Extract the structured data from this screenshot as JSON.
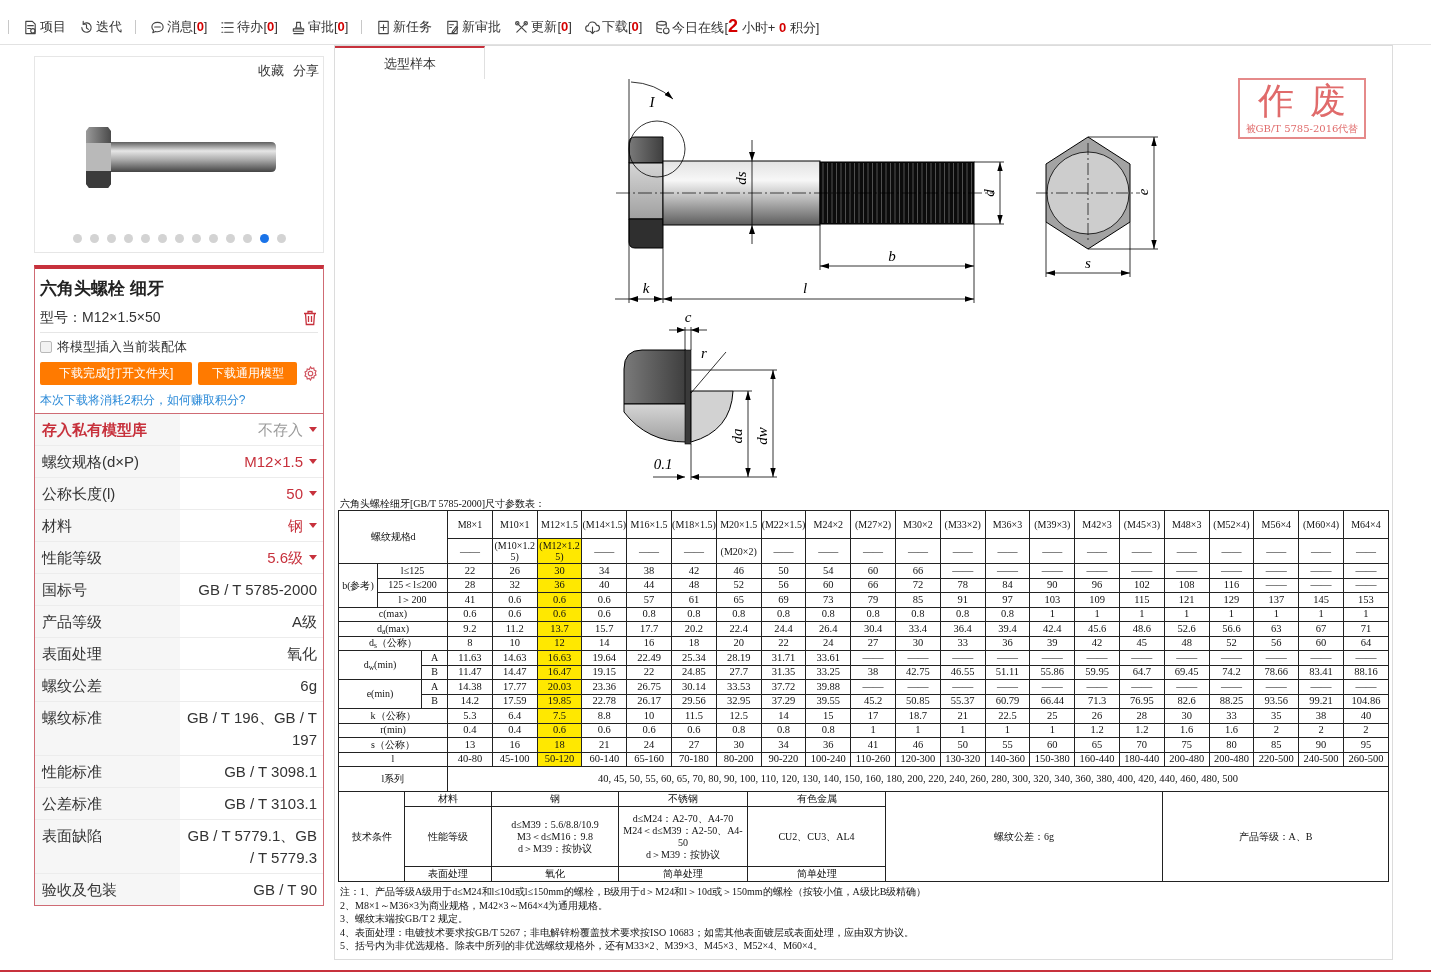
{
  "toolbar": {
    "groups": [
      {
        "items": [
          {
            "kind": "button",
            "label": "项目"
          },
          {
            "kind": "button",
            "label": "迭代"
          }
        ]
      },
      {
        "items": [
          {
            "kind": "button",
            "label": "消息[**0**]"
          },
          {
            "kind": "button",
            "label": "待办[**0**]"
          },
          {
            "kind": "button",
            "label": "审批[**0**]"
          }
        ]
      },
      {
        "items": [
          {
            "kind": "button",
            "label": "新任务"
          },
          {
            "kind": "button",
            "label": "新审批"
          },
          {
            "kind": "button",
            "label": "更新[**0**]"
          },
          {
            "kind": "button",
            "label": "下载[**0**]"
          },
          {
            "kind": "status",
            "label": "今日在线[**2** 小时+ **0** 积分]"
          }
        ]
      }
    ]
  },
  "product_card": {
    "actions": [
      "收藏",
      "分享"
    ],
    "carousel": [
      {
        "selected": false
      },
      {
        "selected": false
      },
      {
        "selected": false
      },
      {
        "selected": false
      },
      {
        "selected": false
      },
      {
        "selected": false
      },
      {
        "selected": false
      },
      {
        "selected": false
      },
      {
        "selected": false
      },
      {
        "selected": false
      },
      {
        "selected": false
      },
      {
        "selected": true
      },
      {
        "selected": false
      }
    ]
  },
  "model_card": {
    "title": "六角头螺栓 细牙",
    "model_number": "型号：M12×1.5×50",
    "insert_option": {
      "label": "将模型插入当前装配体",
      "checked": false
    },
    "buttons": [
      "下载完成[打开文件夹]",
      "下载通用模型"
    ],
    "cost_note": "本次下载将消耗2积分，如何赚取积分?",
    "properties": [
      {
        "kind": "storage",
        "label": "存入私有模型库",
        "value": "不存入"
      },
      {
        "kind": "select",
        "label": "螺纹规格(d×P)",
        "value": "M12×1.5"
      },
      {
        "kind": "select",
        "label": "公称长度(l)",
        "value": "50"
      },
      {
        "kind": "select",
        "label": "材料",
        "value": "钢"
      },
      {
        "kind": "select",
        "label": "性能等级",
        "value": "5.6级"
      },
      {
        "kind": "text",
        "label": "国标号",
        "value": "GB / T 5785-2000"
      },
      {
        "kind": "text",
        "label": "产品等级",
        "value": "A级"
      },
      {
        "kind": "text",
        "label": "表面处理",
        "value": "氧化"
      },
      {
        "kind": "text",
        "label": "螺纹公差",
        "value": "6g"
      },
      {
        "kind": "text",
        "label": "螺纹标准",
        "value": "GB / T 196、GB / T 197"
      },
      {
        "kind": "text",
        "label": "性能标准",
        "value": "GB / T 3098.1"
      },
      {
        "kind": "text",
        "label": "公差标准",
        "value": "GB / T 3103.1"
      },
      {
        "kind": "text",
        "label": "表面缺陷",
        "value": "GB / T 5779.1、GB / T 5779.3"
      },
      {
        "kind": "text",
        "label": "验收及包装",
        "value": "GB / T 90"
      }
    ]
  },
  "sample_panel": {
    "tab": {
      "label": "选型样本",
      "selected": true
    },
    "drawing": {
      "side_view_labels": [
        "ds",
        "d",
        "b",
        "k",
        "l"
      ],
      "detail_mark": "I",
      "end_view_labels": [
        "e",
        "s"
      ],
      "detail_view_labels": [
        "c",
        "r",
        "da",
        "dw",
        "0.1"
      ]
    },
    "stamp": {
      "title": "作废",
      "note": "被GB/T 5785-2016代替"
    },
    "spec_table": {
      "caption": "六角头螺栓细牙[GB/T 5785-2000]尺寸参数表：",
      "header_label": "螺纹规格d",
      "columns": [
        {
          "size": "M8×1",
          "alt": "——",
          "highlighted": false
        },
        {
          "size": "M10×1",
          "alt": "(M10×1.25)",
          "highlighted": false
        },
        {
          "size": "M12×1.5",
          "alt": "(M12×1.25)",
          "highlighted": true
        },
        {
          "size": "(M14×1.5)",
          "alt": "——",
          "highlighted": false
        },
        {
          "size": "M16×1.5",
          "alt": "——",
          "highlighted": false
        },
        {
          "size": "(M18×1.5)",
          "alt": "——",
          "highlighted": false
        },
        {
          "size": "M20×1.5",
          "alt": "(M20×2)",
          "highlighted": false
        },
        {
          "size": "(M22×1.5)",
          "alt": "——",
          "highlighted": false
        },
        {
          "size": "M24×2",
          "alt": "——",
          "highlighted": false
        },
        {
          "size": "(M27×2)",
          "alt": "——",
          "highlighted": false
        },
        {
          "size": "M30×2",
          "alt": "——",
          "highlighted": false
        },
        {
          "size": "(M33×2)",
          "alt": "——",
          "highlighted": false
        },
        {
          "size": "M36×3",
          "alt": "——",
          "highlighted": false
        },
        {
          "size": "(M39×3)",
          "alt": "——",
          "highlighted": false
        },
        {
          "size": "M42×3",
          "alt": "——",
          "highlighted": false
        },
        {
          "size": "(M45×3)",
          "alt": "——",
          "highlighted": false
        },
        {
          "size": "M48×3",
          "alt": "——",
          "highlighted": false
        },
        {
          "size": "(M52×4)",
          "alt": "——",
          "highlighted": false
        },
        {
          "size": "M56×4",
          "alt": "——",
          "highlighted": false
        },
        {
          "size": "(M60×4)",
          "alt": "——",
          "highlighted": false
        },
        {
          "size": "M64×4",
          "alt": "——",
          "highlighted": false
        }
      ],
      "rows": [
        {
          "kind": "range_group",
          "label": "b(参考)",
          "sub_rows": [
            {
              "label": "l≤125",
              "values": [
                "22",
                "26",
                "30",
                "34",
                "38",
                "42",
                "46",
                "50",
                "54",
                "60",
                "66",
                "——",
                "——",
                "——",
                "——",
                "——",
                "——",
                "——",
                "——",
                "——",
                "——"
              ]
            },
            {
              "label": "125＜l≤200",
              "values": [
                "28",
                "32",
                "36",
                "40",
                "44",
                "48",
                "52",
                "56",
                "60",
                "66",
                "72",
                "78",
                "84",
                "90",
                "96",
                "102",
                "108",
                "116",
                "——",
                "——",
                "——"
              ]
            },
            {
              "label": "l＞200",
              "values": [
                "41",
                "0.6",
                "0.6",
                "0.6",
                "57",
                "61",
                "65",
                "69",
                "73",
                "79",
                "85",
                "91",
                "97",
                "103",
                "109",
                "115",
                "121",
                "129",
                "137",
                "145",
                "153"
              ]
            }
          ]
        },
        {
          "kind": "single",
          "label": "c(max)",
          "values": [
            "0.6",
            "0.6",
            "0.6",
            "0.6",
            "0.8",
            "0.8",
            "0.8",
            "0.8",
            "0.8",
            "0.8",
            "0.8",
            "0.8",
            "0.8",
            "1",
            "1",
            "1",
            "1",
            "1",
            "1",
            "1",
            "1"
          ]
        },
        {
          "kind": "single",
          "label": "d$_{a}$(max)",
          "values": [
            "9.2",
            "11.2",
            "13.7",
            "15.7",
            "17.7",
            "20.2",
            "22.4",
            "24.4",
            "26.4",
            "30.4",
            "33.4",
            "36.4",
            "39.4",
            "42.4",
            "45.6",
            "48.6",
            "52.6",
            "56.6",
            "63",
            "67",
            "71"
          ]
        },
        {
          "kind": "single",
          "label": "d$_{s}$（公称）",
          "values": [
            "8",
            "10",
            "12",
            "14",
            "16",
            "18",
            "20",
            "22",
            "24",
            "27",
            "30",
            "33",
            "36",
            "39",
            "42",
            "45",
            "48",
            "52",
            "56",
            "60",
            "64"
          ]
        },
        {
          "kind": "grade_group",
          "label": "d$_{w}$(min)",
          "sub_rows": [
            {
              "label": "A",
              "values": [
                "11.63",
                "14.63",
                "16.63",
                "19.64",
                "22.49",
                "25.34",
                "28.19",
                "31.71",
                "33.61",
                "——",
                "——",
                "——",
                "——",
                "——",
                "——",
                "——",
                "——",
                "——",
                "——",
                "——",
                "——"
              ]
            },
            {
              "label": "B",
              "values": [
                "11.47",
                "14.47",
                "16.47",
                "19.15",
                "22",
                "24.85",
                "27.7",
                "31.35",
                "33.25",
                "38",
                "42.75",
                "46.55",
                "51.11",
                "55.86",
                "59.95",
                "64.7",
                "69.45",
                "74.2",
                "78.66",
                "83.41",
                "88.16"
              ]
            }
          ]
        },
        {
          "kind": "grade_group",
          "label": "e(min)",
          "sub_rows": [
            {
              "label": "A",
              "values": [
                "14.38",
                "17.77",
                "20.03",
                "23.36",
                "26.75",
                "30.14",
                "33.53",
                "37.72",
                "39.88",
                "——",
                "——",
                "——",
                "——",
                "——",
                "——",
                "——",
                "——",
                "——",
                "——",
                "——",
                "——"
              ]
            },
            {
              "label": "B",
              "values": [
                "14.2",
                "17.59",
                "19.85",
                "22.78",
                "26.17",
                "29.56",
                "32.95",
                "37.29",
                "39.55",
                "45.2",
                "50.85",
                "55.37",
                "60.79",
                "66.44",
                "71.3",
                "76.95",
                "82.6",
                "88.25",
                "93.56",
                "99.21",
                "104.86"
              ]
            }
          ]
        },
        {
          "kind": "single",
          "label": "k（公称）",
          "values": [
            "5.3",
            "6.4",
            "7.5",
            "8.8",
            "10",
            "11.5",
            "12.5",
            "14",
            "15",
            "17",
            "18.7",
            "21",
            "22.5",
            "25",
            "26",
            "28",
            "30",
            "33",
            "35",
            "38",
            "40"
          ]
        },
        {
          "kind": "single",
          "label": "r(min)",
          "values": [
            "0.4",
            "0.4",
            "0.6",
            "0.6",
            "0.6",
            "0.6",
            "0.8",
            "0.8",
            "0.8",
            "1",
            "1",
            "1",
            "1",
            "1",
            "1.2",
            "1.2",
            "1.6",
            "1.6",
            "2",
            "2",
            "2"
          ]
        },
        {
          "kind": "single",
          "label": "s（公称）",
          "values": [
            "13",
            "16",
            "18",
            "21",
            "24",
            "27",
            "30",
            "34",
            "36",
            "41",
            "46",
            "50",
            "55",
            "60",
            "65",
            "70",
            "75",
            "80",
            "85",
            "90",
            "95"
          ]
        },
        {
          "kind": "single",
          "label": "l",
          "values": [
            "40-80",
            "45-100",
            "50-120",
            "60-140",
            "65-160",
            "70-180",
            "80-200",
            "90-220",
            "100-240",
            "110-260",
            "120-300",
            "130-320",
            "140-360",
            "150-380",
            "160-440",
            "180-440",
            "200-480",
            "200-480",
            "220-500",
            "240-500",
            "260-500"
          ]
        },
        {
          "kind": "series",
          "label": "l系列",
          "text": "40, 45, 50, 55, 60, 65, 70, 80, 90, 100, 110, 120, 130, 140, 150, 160, 180, 200, 220, 240, 260, 280, 300, 320, 340, 360, 380, 400, 420, 440, 460, 480, 500"
        }
      ]
    },
    "tech_conditions": {
      "label": "技术条件",
      "rows": [
        {
          "cells": [
            "材料",
            "钢",
            "不锈钢",
            "有色金属"
          ]
        },
        {
          "cells": [
            "性能等级",
            "d≤M39：5.6/8.8/10.9\nM3＜d≤M16：9.8\nd＞M39：按协议",
            "d≤M24：A2-70、A4-70\nM24＜d≤M39：A2-50、A4-50\nd＞M39：按协议",
            "CU2、CU3、AL4"
          ]
        },
        {
          "cells": [
            "表面处理",
            "氧化",
            "简单处理",
            "简单处理"
          ]
        }
      ],
      "thread_tolerance": "螺纹公差：6g",
      "product_grade": "产品等级：A、B"
    },
    "notes": [
      "注：1、产品等级A级用于d≤M24和l≤10d或l≤150mm的螺栓，B级用于d＞M24和l＞10d或＞150mm的螺栓（按较小值，A级比B级精确）",
      "2、M8×1～M36×3为商业规格，M42×3～M64×4为通用规格。",
      "3、螺纹末端按GB/T 2 规定。",
      "4、表面处理：电镀技术要求按GB/T 5267；非电解锌粉覆盖技术要求按ISO 10683；如需其他表面镀层或表面处理，应由双方协议。",
      "5、括号内为非优选规格。除表中所列的非优选螺纹规格外，还有M33×2、M39×3、M45×3、M52×4、M60×4。"
    ]
  }
}
